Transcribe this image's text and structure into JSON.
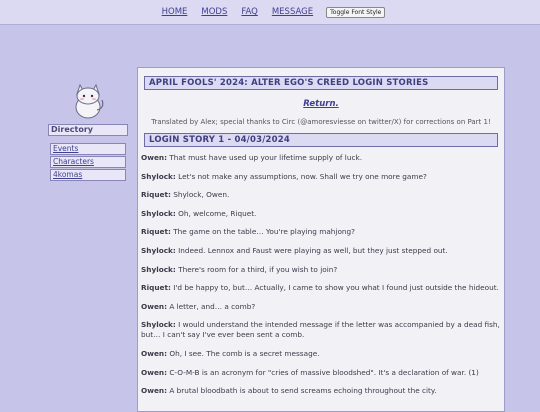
{
  "nav": {
    "links": [
      "HOME",
      "MODS",
      "FAQ",
      "MESSAGE"
    ],
    "toggle_label": "Toggle Font Style"
  },
  "sidebar": {
    "title": "Directory",
    "links": [
      "Events",
      "Characters",
      "4komas"
    ]
  },
  "main": {
    "title": "APRIL FOOLS' 2024: ALTER EGO'S CREED LOGIN STORIES",
    "return_label": "Return.",
    "credits": "Translated by Alex; special thanks to Circ (@amoresviesse on twitter/X) for corrections on Part 1!",
    "section_title": "LOGIN STORY 1 - 04/03/2024",
    "dialogue": [
      {
        "speaker": "Owen:",
        "text": " That must have used up your lifetime supply of luck."
      },
      {
        "speaker": "Shylock:",
        "text": " Let's not make any assumptions, now. Shall we try one more game?"
      },
      {
        "speaker": "Riquet:",
        "text": " Shylock, Owen."
      },
      {
        "speaker": "Shylock:",
        "text": " Oh, welcome, Riquet."
      },
      {
        "speaker": "Riquet:",
        "text": " The game on the table… You're playing mahjong?"
      },
      {
        "speaker": "Shylock:",
        "text": " Indeed. Lennox and Faust were playing as well, but they just stepped out."
      },
      {
        "speaker": "Shylock:",
        "text": " There's room for a third, if you wish to join?"
      },
      {
        "speaker": "Riquet:",
        "text": " I'd be happy to, but… Actually, I came to show you what I found just outside the hideout."
      },
      {
        "speaker": "Owen:",
        "text": " A letter, and… a comb?"
      },
      {
        "speaker": "Shylock:",
        "text": " I would understand the intended message if the letter was accompanied by a dead fish, but… I can't say I've ever been sent a comb."
      },
      {
        "speaker": "Owen:",
        "text": " Oh, I see. The comb is a secret message."
      },
      {
        "speaker": "Owen:",
        "text": " C-O-M-B is an acronym for \"cries of massive bloodshed\". It's a declaration of war. (1)"
      },
      {
        "speaker": "Owen:",
        "text": " A brutal bloodbath is about to send screams echoing throughout the city."
      }
    ]
  }
}
